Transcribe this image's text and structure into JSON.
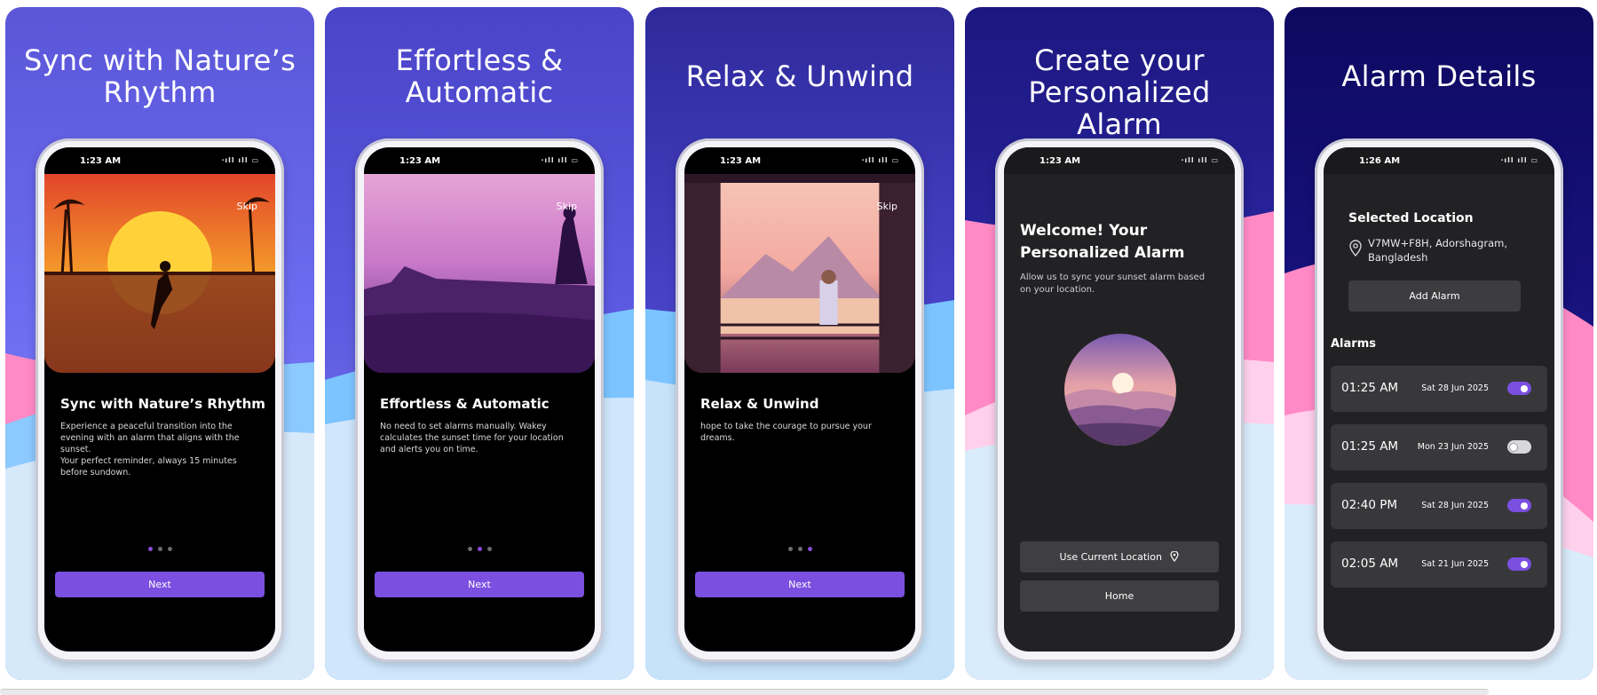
{
  "colors": {
    "accent": "#7b4fe0",
    "dot_active": "#8b4ad6",
    "panel_top_1": "#5b56d8",
    "panel_top_5": "#0d0960",
    "wave_pink": "#ff8ac6",
    "wave_blue": "#7cc4ff"
  },
  "panels": [
    {
      "title": "Sync with Nature’s Rhythm",
      "status_time": "1:23 AM",
      "skip": "Skip",
      "heading": "Sync with Nature’s Rhythm",
      "body": "Experience a peaceful transition into the evening with an alarm that aligns with the sunset.\nYour perfect reminder, always 15 minutes before sundown.",
      "next": "Next"
    },
    {
      "title": "Effortless & Automatic",
      "status_time": "1:23 AM",
      "skip": "Skip",
      "heading": "Effortless & Automatic",
      "body": "No need to set alarms manually. Wakey calculates the sunset time for your location and alerts you on time.",
      "next": "Next"
    },
    {
      "title": "Relax & Unwind",
      "status_time": "1:23 AM",
      "skip": "Skip",
      "heading": "Relax & Unwind",
      "body": "hope to take the courage to pursue your dreams.",
      "next": "Next"
    },
    {
      "title": "Create your Personalized Alarm",
      "status_time": "1:23 AM",
      "welcome": "Welcome! Your Personalized Alarm",
      "sub": "Allow us to sync your sunset alarm based on your location.",
      "use_location": "Use Current Location",
      "home": "Home"
    },
    {
      "title": "Alarm Details",
      "status_time": "1:26 AM",
      "selected_location": "Selected Location",
      "location": "V7MW+F8H, Adorshagram, Bangladesh",
      "add_alarm": "Add Alarm",
      "alarms_heading": "Alarms",
      "alarms": [
        {
          "time": "01:25 AM",
          "date": "Sat 28 Jun 2025",
          "on": true
        },
        {
          "time": "01:25 AM",
          "date": "Mon 23 Jun 2025",
          "on": false
        },
        {
          "time": "02:40 PM",
          "date": "Sat 28 Jun 2025",
          "on": true
        },
        {
          "time": "02:05 AM",
          "date": "Sat 21 Jun 2025",
          "on": true
        }
      ]
    }
  ],
  "onboarding_dots": [
    {
      "active_index": 0
    },
    {
      "active_index": 1
    },
    {
      "active_index": 2
    }
  ],
  "icons": {
    "status_icons": "wifi-signal-battery-icons",
    "location": "map-pin-icon"
  }
}
